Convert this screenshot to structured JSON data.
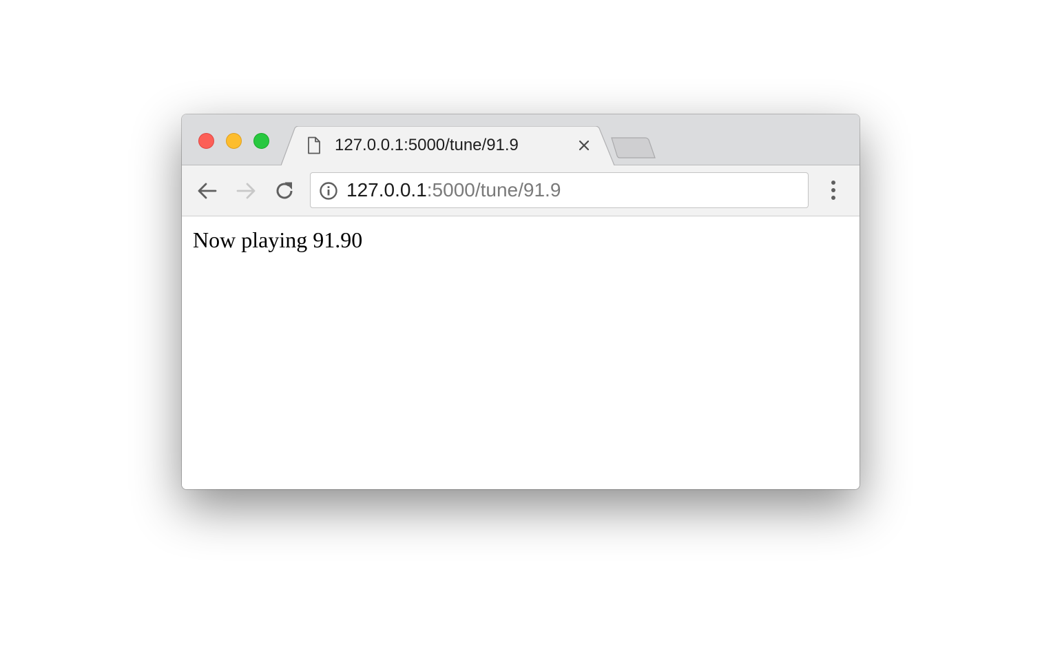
{
  "window": {
    "controls": {
      "close_color": "#fc5f57",
      "minimize_color": "#fdbd2e",
      "zoom_color": "#28c840"
    }
  },
  "tab": {
    "title": "127.0.0.1:5000/tune/91.9",
    "icon": "document-icon",
    "close_icon": "close-icon"
  },
  "newtab": {
    "icon": "new-tab-icon"
  },
  "toolbar": {
    "back_icon": "back-arrow-icon",
    "forward_icon": "forward-arrow-icon",
    "reload_icon": "reload-icon",
    "menu_icon": "kebab-menu-icon"
  },
  "address": {
    "security_icon": "info-icon",
    "host": "127.0.0.1",
    "rest": ":5000/tune/91.9"
  },
  "page": {
    "text": "Now playing 91.90"
  }
}
